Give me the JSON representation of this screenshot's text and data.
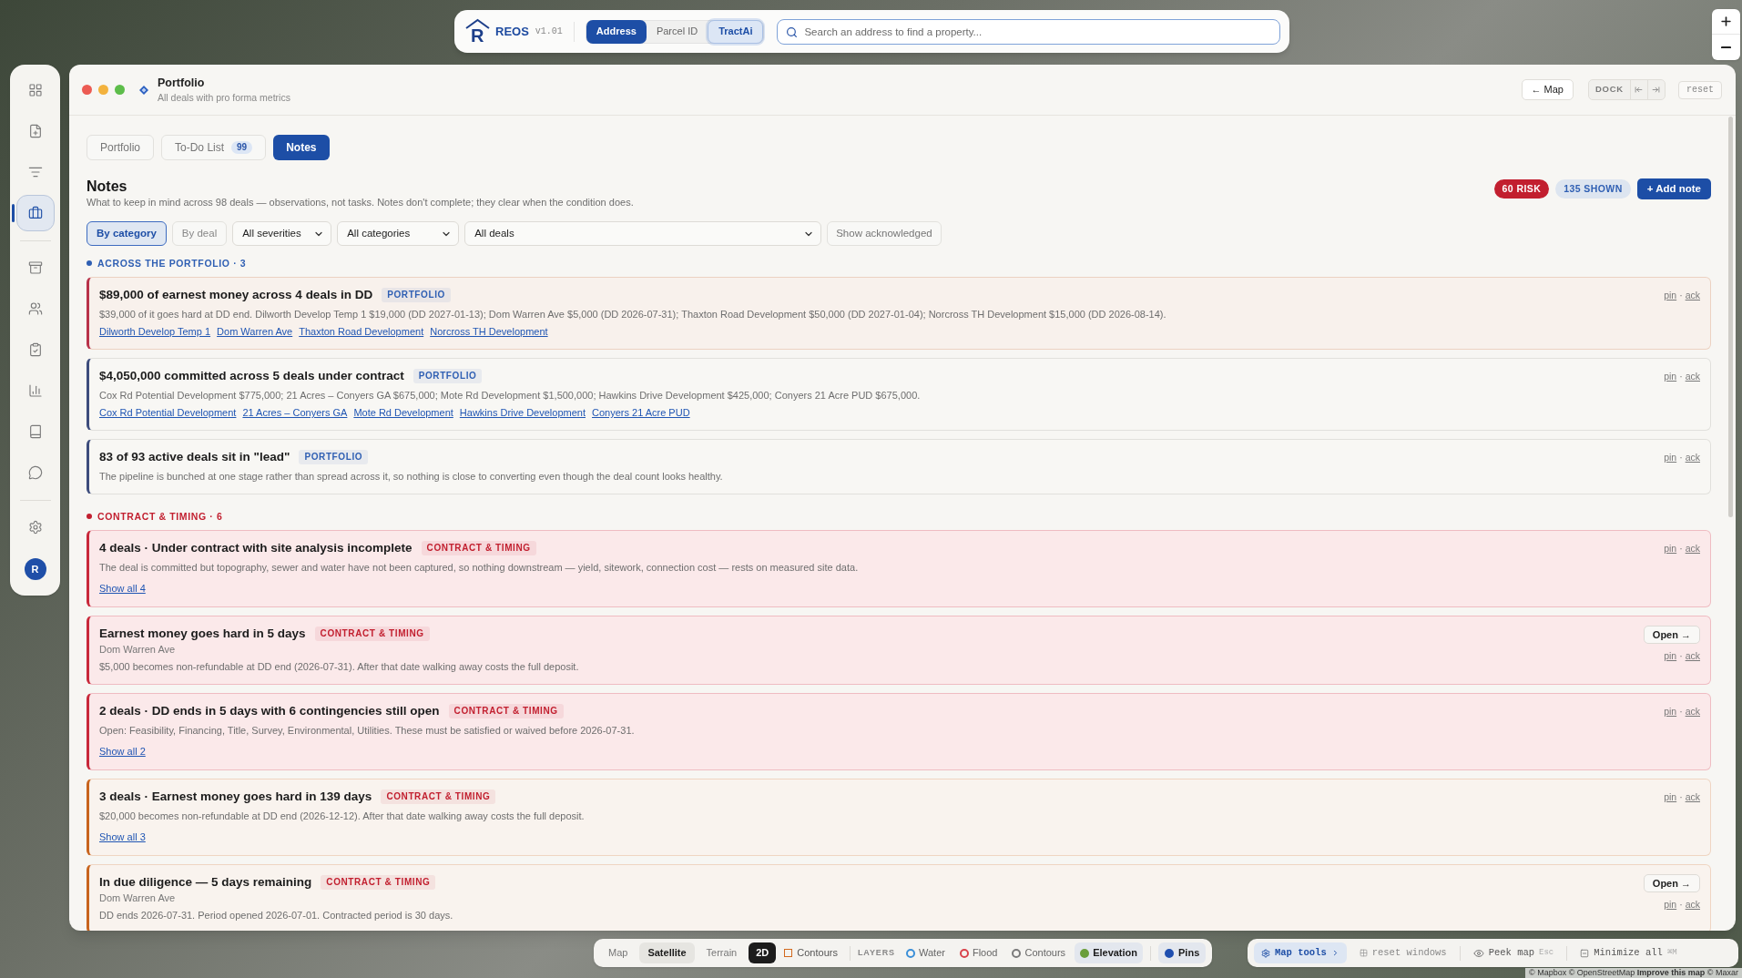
{
  "map": {
    "attribution": "© Mapbox © OpenStreetMap **Improve this map** © Maxar"
  },
  "top_bar": {
    "logo_letter": "R",
    "brand": "REOS",
    "version": "v1.01",
    "modes": [
      {
        "label": "Address",
        "selected": true,
        "kind": "mode"
      },
      {
        "label": "Parcel ID",
        "selected": false,
        "kind": "mode"
      },
      {
        "label": "TractAi",
        "selected": false,
        "kind": "ai"
      }
    ],
    "search": {
      "placeholder": "Search an address to find a property..."
    }
  },
  "rail": {
    "groups": [
      [
        {
          "selected": false
        },
        {
          "selected": false
        },
        {
          "selected": false
        },
        {
          "selected": true
        }
      ],
      [
        {
          "selected": false
        },
        {
          "selected": false
        },
        {
          "selected": false
        },
        {
          "selected": false
        },
        {
          "selected": false
        },
        {
          "selected": false
        }
      ],
      [
        {
          "selected": false
        }
      ]
    ],
    "avatar": "R"
  },
  "window": {
    "title": "Portfolio",
    "subtitle": "All deals with pro forma metrics",
    "map_button": "← Map",
    "dock_label": "DOCK",
    "reset_button": "reset"
  },
  "tabs": [
    {
      "label": "Portfolio",
      "selected": false
    },
    {
      "label": "To-Do List",
      "count": "99",
      "selected": false
    },
    {
      "label": "Notes",
      "selected": true
    }
  ],
  "notes_panel": {
    "title": "Notes",
    "description": "What to keep in mind across 98 deals — observations, not tasks. Notes don't complete; they clear when the condition does.",
    "badges": [
      {
        "label": "60 RISK",
        "kind": "risk"
      },
      {
        "label": "135 SHOWN",
        "kind": "count"
      }
    ],
    "add_button": "+ Add note",
    "filters": {
      "groupings": [
        {
          "label": "By category",
          "selected": true
        },
        {
          "label": "By deal",
          "selected": false
        }
      ],
      "dropdowns": [
        "All severities",
        "All categories",
        "All deals"
      ],
      "show_acknowledged": "Show acknowledged"
    },
    "sections": [
      {
        "title": "ACROSS THE PORTFOLIO · 3",
        "color": "#2f5fb3",
        "notes": [
          {
            "kind": "elevated",
            "title": "$89,000 of earnest money across 4 deals in DD",
            "tag": "PORTFOLIO",
            "body": "$39,000 of it goes hard at DD end. Dilworth Develop Temp 1 $19,000 (DD 2027-01-13); Dom Warren Ave $5,000 (DD 2026-07-31); Thaxton Road Development $50,000 (DD 2027-01-04); Norcross TH Development $15,000 (DD 2026-08-14).",
            "links": [
              "Dilworth Develop Temp 1",
              "Dom Warren Ave",
              "Thaxton Road Development",
              "Norcross TH Development"
            ],
            "actions": [
              "pin",
              "ack"
            ],
            "separator": "·"
          },
          {
            "kind": "info",
            "title": "$4,050,000 committed across 5 deals under contract",
            "tag": "PORTFOLIO",
            "body": "Cox Rd Potential Development $775,000; 21 Acres – Conyers GA $675,000; Mote Rd Development $1,500,000; Hawkins Drive Development $425,000; Conyers 21 Acre PUD $675,000.",
            "links": [
              "Cox Rd Potential Development",
              "21 Acres – Conyers GA",
              "Mote Rd Development",
              "Hawkins Drive Development",
              "Conyers 21 Acre PUD"
            ],
            "actions": [
              "pin",
              "ack"
            ],
            "separator": "·"
          },
          {
            "kind": "info",
            "title": "83 of 93 active deals sit in \"lead\"",
            "tag": "PORTFOLIO",
            "body": "The pipeline is bunched at one stage rather than spread across it, so nothing is close to converting even though the deal count looks healthy.",
            "actions": [
              "pin",
              "ack"
            ],
            "separator": "·"
          }
        ]
      },
      {
        "title": "CONTRACT & TIMING · 6",
        "color": "#c21f2f",
        "notes": [
          {
            "kind": "risk",
            "title": "4 deals · Under contract with site analysis incomplete",
            "tag": "CONTRACT & TIMING",
            "body": "The deal is committed but topography, sewer and water have not been captured, so nothing downstream — yield, sitework, connection cost — rests on measured site data.",
            "show_all": "Show all 4",
            "actions": [
              "pin",
              "ack"
            ],
            "separator": "·"
          },
          {
            "kind": "risk",
            "title": "Earnest money goes hard in 5 days",
            "tag": "CONTRACT & TIMING",
            "subtitle": "Dom Warren Ave",
            "body": "$5,000 becomes non-refundable at DD end (2026-07-31). After that date walking away costs the full deposit.",
            "open_button": "Open →",
            "actions": [
              "pin",
              "ack"
            ],
            "separator": "·"
          },
          {
            "kind": "risk",
            "title": "2 deals · DD ends in 5 days with 6 contingencies still open",
            "tag": "CONTRACT & TIMING",
            "body": "Open: Feasibility, Financing, Title, Survey, Environmental, Utilities. These must be satisfied or waived before 2026-07-31.",
            "show_all": "Show all 2",
            "actions": [
              "pin",
              "ack"
            ],
            "separator": "·"
          },
          {
            "kind": "caution",
            "title": "3 deals · Earnest money goes hard in 139 days",
            "tag": "CONTRACT & TIMING",
            "body": "$20,000 becomes non-refundable at DD end (2026-12-12). After that date walking away costs the full deposit.",
            "show_all": "Show all 3",
            "actions": [
              "pin",
              "ack"
            ],
            "separator": "·"
          },
          {
            "kind": "caution",
            "title": "In due diligence — 5 days remaining",
            "tag": "CONTRACT & TIMING",
            "subtitle": "Dom Warren Ave",
            "body": "DD ends 2026-07-31. Period opened 2026-07-01. Contracted period is 30 days.",
            "open_button": "Open →",
            "actions": [
              "pin",
              "ack"
            ],
            "separator": "·"
          }
        ]
      }
    ]
  },
  "map_toolbar": {
    "styles": [
      {
        "label": "Map",
        "selected": false
      },
      {
        "label": "Satellite",
        "selected": true
      },
      {
        "label": "Terrain",
        "selected": false
      }
    ],
    "dimension": {
      "label": "2D",
      "on": true
    },
    "contours": {
      "label": "Contours",
      "checked": false
    },
    "layers_label": "LAYERS",
    "layers": [
      {
        "label": "Water",
        "color": "#3b8fd8",
        "on": false
      },
      {
        "label": "Flood",
        "color": "#d8424a",
        "on": false
      },
      {
        "label": "Contours",
        "color": "#7a7a7a",
        "on": false
      },
      {
        "label": "Elevation",
        "color": "#6a9e3a",
        "on": true
      }
    ],
    "pins": {
      "label": "Pins",
      "color": "#1f4fb0",
      "on": true
    }
  },
  "window_tools": {
    "map_tools": "Map tools",
    "reset_windows": "reset windows",
    "peek_map": "Peek map",
    "peek_key": "Esc",
    "minimize_all": "Minimize all",
    "minimize_key": "⌘M"
  }
}
